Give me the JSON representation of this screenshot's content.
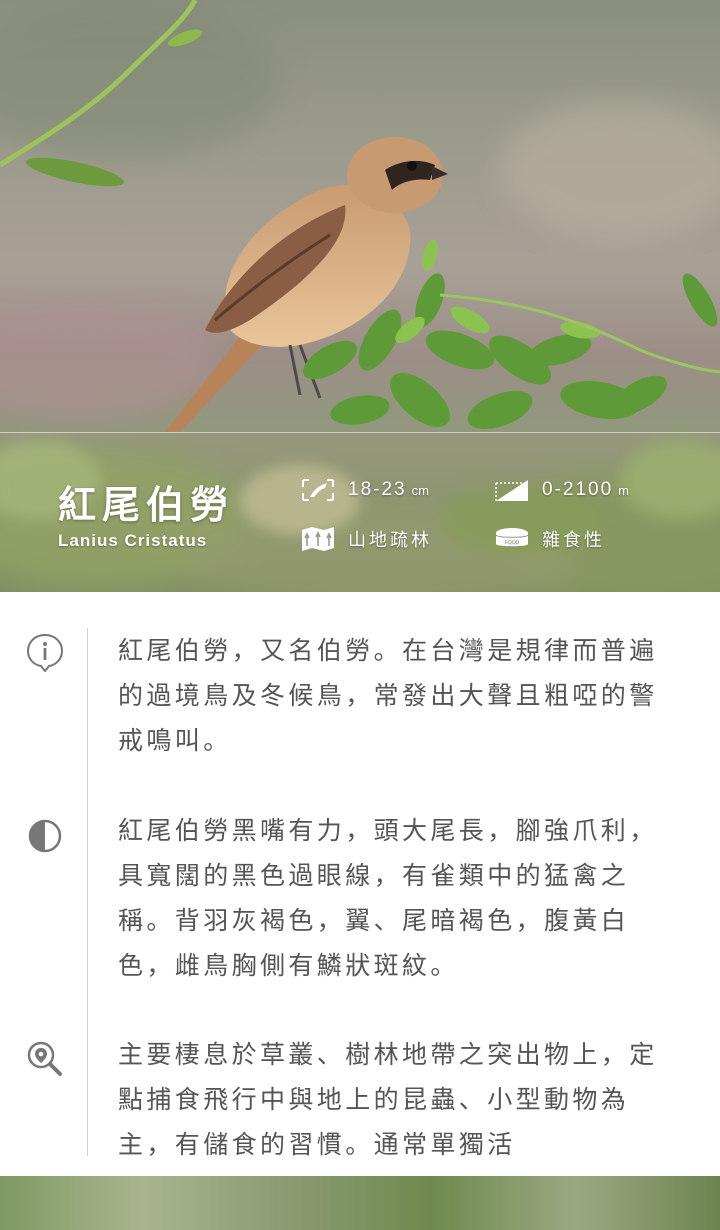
{
  "species": {
    "name_zh": "紅尾伯勞",
    "name_en": "Lanius Cristatus"
  },
  "stats": {
    "size": {
      "icon": "bird-size-icon",
      "value": "18-23",
      "unit": "cm"
    },
    "altitude": {
      "icon": "altitude-icon",
      "value": "0-2100",
      "unit": "m"
    },
    "habitat": {
      "icon": "forest-map-icon",
      "text": "山地疏林"
    },
    "diet": {
      "icon": "food-can-icon",
      "text": "雜食性",
      "icon_text": "FOOD"
    }
  },
  "sections": [
    {
      "icon": "info-icon",
      "text": "紅尾伯勞，又名伯勞。在台灣是規律而普遍的過境鳥及冬候鳥，常發出大聲且粗啞的警戒鳴叫。"
    },
    {
      "icon": "contrast-icon",
      "text": "紅尾伯勞黑嘴有力，頭大尾長，腳強爪利，具寬闊的黑色過眼線，有雀類中的猛禽之稱。背羽灰褐色，翼、尾暗褐色，腹黃白色，雌鳥胸側有鱗狀斑紋。"
    },
    {
      "icon": "location-search-icon",
      "text": "主要棲息於草叢、樹林地帶之突出物上，定點捕食飛行中與地上的昆蟲、小型動物為主，有儲食的習慣。通常單獨活"
    }
  ],
  "colors": {
    "text": "#555555",
    "divider": "#cfcfcf",
    "overlay_text": "#ffffff"
  }
}
